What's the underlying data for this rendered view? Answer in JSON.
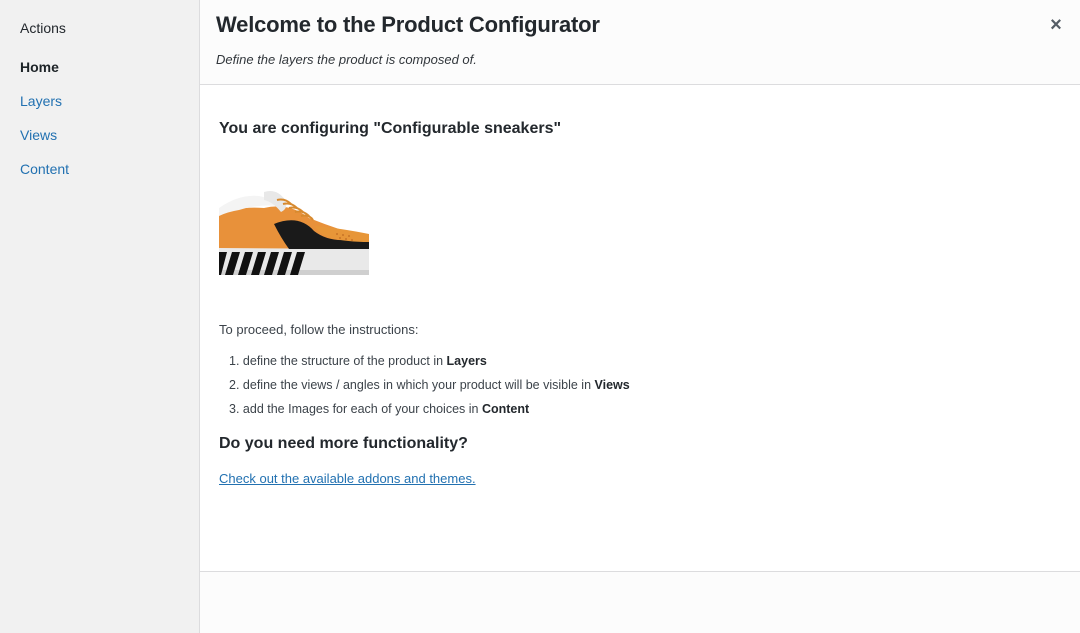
{
  "sidebar": {
    "heading": "Actions",
    "items": [
      {
        "label": "Home",
        "current": true
      },
      {
        "label": "Layers",
        "current": false
      },
      {
        "label": "Views",
        "current": false
      },
      {
        "label": "Content",
        "current": false
      }
    ]
  },
  "header": {
    "title": "Welcome to the Product Configurator",
    "subtitle": "Define the layers the product is composed of.",
    "close_icon": "close-icon"
  },
  "main": {
    "configuring_prefix": "You are configuring ",
    "product_name": "\"Configurable sneakers\"",
    "product_image_icon": "sneaker-image",
    "intro": "To proceed, follow the instructions:",
    "steps": [
      {
        "number": "1.",
        "text": "define the structure of the product in ",
        "emphasis": "Layers"
      },
      {
        "number": "2.",
        "text": "define the views / angles in which your product will be visible in ",
        "emphasis": "Views"
      },
      {
        "number": "3.",
        "text": "add the Images for each of your choices in ",
        "emphasis": "Content"
      }
    ],
    "more_heading": "Do you need more functionality?",
    "addons_link": "Check out the available addons and themes."
  },
  "colors": {
    "link": "#2271b1",
    "text": "#23282d",
    "sneaker_orange": "#e8913a",
    "sneaker_black": "#1a1a1a"
  }
}
